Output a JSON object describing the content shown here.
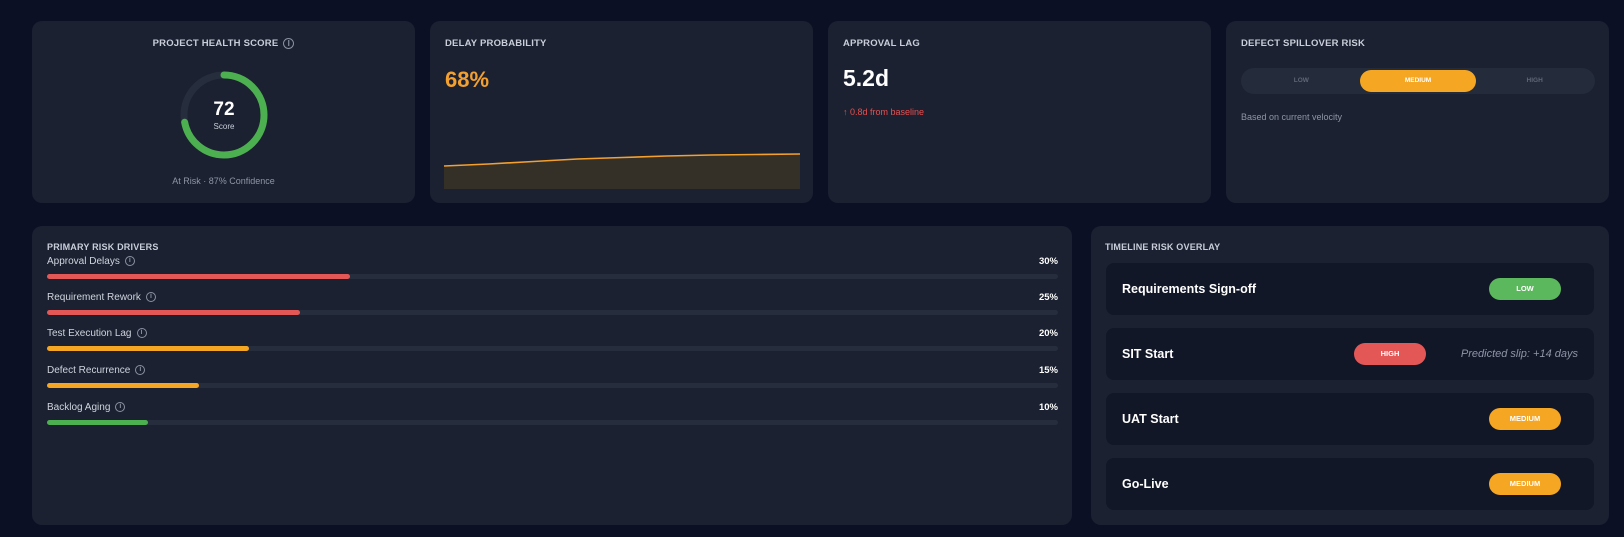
{
  "health": {
    "title": "PROJECT HEALTH SCORE",
    "info_icon": "info-icon",
    "score": "72",
    "score_label": "Score",
    "score_fraction": 0.72,
    "footer": "At Risk · 87% Confidence",
    "gauge_color": "#4caf50"
  },
  "delay": {
    "title": "DELAY PROBABILITY",
    "value": "68%",
    "color": "#f4a02e",
    "sparkline": [
      0.46,
      0.5,
      0.55,
      0.6,
      0.63,
      0.66,
      0.68,
      0.69,
      0.7
    ]
  },
  "approval": {
    "title": "APPROVAL LAG",
    "value": "5.2d",
    "trend": "↑ 0.8d from baseline",
    "trend_color": "#e85050"
  },
  "defect": {
    "title": "DEFECT SPILLOVER RISK",
    "options": [
      "LOW",
      "MEDIUM",
      "HIGH"
    ],
    "selected": "MEDIUM",
    "note": "Based on current velocity"
  },
  "drivers": {
    "title": "PRIMARY RISK DRIVERS",
    "items": [
      {
        "label": "Approval Delays",
        "pct": "30%",
        "fraction": 0.3,
        "color": "#e45757"
      },
      {
        "label": "Requirement Rework",
        "pct": "25%",
        "fraction": 0.25,
        "color": "#e45757"
      },
      {
        "label": "Test Execution Lag",
        "pct": "20%",
        "fraction": 0.2,
        "color": "#f5a623"
      },
      {
        "label": "Defect Recurrence",
        "pct": "15%",
        "fraction": 0.15,
        "color": "#f5a623"
      },
      {
        "label": "Backlog Aging",
        "pct": "10%",
        "fraction": 0.1,
        "color": "#4caf50"
      }
    ]
  },
  "timeline": {
    "title": "TIMELINE RISK OVERLAY",
    "rows": [
      {
        "name": "Requirements Sign-off",
        "risk": "LOW",
        "color": "#5cb85c",
        "note": ""
      },
      {
        "name": "SIT Start",
        "risk": "HIGH",
        "color": "#e45757",
        "note": "Predicted slip: +14 days"
      },
      {
        "name": "UAT Start",
        "risk": "MEDIUM",
        "color": "#f5a623",
        "note": ""
      },
      {
        "name": "Go-Live",
        "risk": "MEDIUM",
        "color": "#f5a623",
        "note": ""
      }
    ]
  }
}
